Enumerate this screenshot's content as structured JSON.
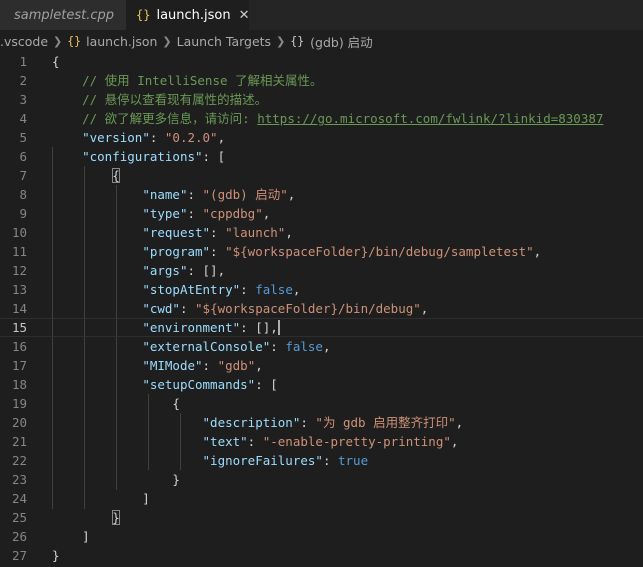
{
  "tabs": [
    {
      "label": "sampletest.cpp",
      "active": false
    },
    {
      "label": "launch.json",
      "active": true,
      "icon": "{}"
    }
  ],
  "breadcrumb": {
    "items": [
      ".vscode",
      "launch.json",
      "Launch Targets",
      "(gdb) 启动"
    ],
    "json_icon": "{}"
  },
  "colors": {
    "key": "#9cdcfe",
    "string": "#ce9178",
    "boolean": "#569cd6",
    "comment": "#6a9955",
    "background": "#1e1e1e"
  },
  "editor": {
    "current_line": 15,
    "lines": [
      {
        "n": "1",
        "tokens": [
          {
            "t": "p",
            "v": "{"
          }
        ]
      },
      {
        "n": "2",
        "tokens": [
          {
            "t": "c",
            "v": "    // 使用 IntelliSense 了解相关属性。"
          }
        ]
      },
      {
        "n": "3",
        "tokens": [
          {
            "t": "c",
            "v": "    // 悬停以查看现有属性的描述。"
          }
        ]
      },
      {
        "n": "4",
        "tokens": [
          {
            "t": "c",
            "v": "    // 欲了解更多信息，请访问: "
          },
          {
            "t": "l",
            "v": "https://go.microsoft.com/fwlink/?linkid=830387"
          }
        ]
      },
      {
        "n": "5",
        "tokens": [
          {
            "t": "p",
            "v": "    "
          },
          {
            "t": "k",
            "v": "\"version\""
          },
          {
            "t": "p",
            "v": ": "
          },
          {
            "t": "s",
            "v": "\"0.2.0\""
          },
          {
            "t": "p",
            "v": ","
          }
        ]
      },
      {
        "n": "6",
        "tokens": [
          {
            "t": "p",
            "v": "    "
          },
          {
            "t": "k",
            "v": "\"configurations\""
          },
          {
            "t": "p",
            "v": ": ["
          }
        ]
      },
      {
        "n": "7",
        "tokens": [
          {
            "t": "p",
            "v": "        "
          },
          {
            "t": "h",
            "v": "{"
          }
        ]
      },
      {
        "n": "8",
        "tokens": [
          {
            "t": "p",
            "v": "            "
          },
          {
            "t": "k",
            "v": "\"name\""
          },
          {
            "t": "p",
            "v": ": "
          },
          {
            "t": "s",
            "v": "\"(gdb) 启动\""
          },
          {
            "t": "p",
            "v": ","
          }
        ]
      },
      {
        "n": "9",
        "tokens": [
          {
            "t": "p",
            "v": "            "
          },
          {
            "t": "k",
            "v": "\"type\""
          },
          {
            "t": "p",
            "v": ": "
          },
          {
            "t": "s",
            "v": "\"cppdbg\""
          },
          {
            "t": "p",
            "v": ","
          }
        ]
      },
      {
        "n": "10",
        "tokens": [
          {
            "t": "p",
            "v": "            "
          },
          {
            "t": "k",
            "v": "\"request\""
          },
          {
            "t": "p",
            "v": ": "
          },
          {
            "t": "s",
            "v": "\"launch\""
          },
          {
            "t": "p",
            "v": ","
          }
        ]
      },
      {
        "n": "11",
        "tokens": [
          {
            "t": "p",
            "v": "            "
          },
          {
            "t": "k",
            "v": "\"program\""
          },
          {
            "t": "p",
            "v": ": "
          },
          {
            "t": "s",
            "v": "\"${workspaceFolder}/bin/debug/sampletest\""
          },
          {
            "t": "p",
            "v": ","
          }
        ]
      },
      {
        "n": "12",
        "tokens": [
          {
            "t": "p",
            "v": "            "
          },
          {
            "t": "k",
            "v": "\"args\""
          },
          {
            "t": "p",
            "v": ": [],"
          }
        ]
      },
      {
        "n": "13",
        "tokens": [
          {
            "t": "p",
            "v": "            "
          },
          {
            "t": "k",
            "v": "\"stopAtEntry\""
          },
          {
            "t": "p",
            "v": ": "
          },
          {
            "t": "b",
            "v": "false"
          },
          {
            "t": "p",
            "v": ","
          }
        ]
      },
      {
        "n": "14",
        "tokens": [
          {
            "t": "p",
            "v": "            "
          },
          {
            "t": "k",
            "v": "\"cwd\""
          },
          {
            "t": "p",
            "v": ": "
          },
          {
            "t": "s",
            "v": "\"${workspaceFolder}/bin/debug\""
          },
          {
            "t": "p",
            "v": ","
          }
        ]
      },
      {
        "n": "15",
        "tokens": [
          {
            "t": "p",
            "v": "            "
          },
          {
            "t": "k",
            "v": "\"environment\""
          },
          {
            "t": "p",
            "v": ": [],"
          },
          {
            "t": "cur",
            "v": ""
          }
        ]
      },
      {
        "n": "16",
        "tokens": [
          {
            "t": "p",
            "v": "            "
          },
          {
            "t": "k",
            "v": "\"externalConsole\""
          },
          {
            "t": "p",
            "v": ": "
          },
          {
            "t": "b",
            "v": "false"
          },
          {
            "t": "p",
            "v": ","
          }
        ]
      },
      {
        "n": "17",
        "tokens": [
          {
            "t": "p",
            "v": "            "
          },
          {
            "t": "k",
            "v": "\"MIMode\""
          },
          {
            "t": "p",
            "v": ": "
          },
          {
            "t": "s",
            "v": "\"gdb\""
          },
          {
            "t": "p",
            "v": ","
          }
        ]
      },
      {
        "n": "18",
        "tokens": [
          {
            "t": "p",
            "v": "            "
          },
          {
            "t": "k",
            "v": "\"setupCommands\""
          },
          {
            "t": "p",
            "v": ": ["
          }
        ]
      },
      {
        "n": "19",
        "tokens": [
          {
            "t": "p",
            "v": "                {"
          }
        ]
      },
      {
        "n": "20",
        "tokens": [
          {
            "t": "p",
            "v": "                    "
          },
          {
            "t": "k",
            "v": "\"description\""
          },
          {
            "t": "p",
            "v": ": "
          },
          {
            "t": "s",
            "v": "\"为 gdb 启用整齐打印\""
          },
          {
            "t": "p",
            "v": ","
          }
        ]
      },
      {
        "n": "21",
        "tokens": [
          {
            "t": "p",
            "v": "                    "
          },
          {
            "t": "k",
            "v": "\"text\""
          },
          {
            "t": "p",
            "v": ": "
          },
          {
            "t": "s",
            "v": "\"-enable-pretty-printing\""
          },
          {
            "t": "p",
            "v": ","
          }
        ]
      },
      {
        "n": "22",
        "tokens": [
          {
            "t": "p",
            "v": "                    "
          },
          {
            "t": "k",
            "v": "\"ignoreFailures\""
          },
          {
            "t": "p",
            "v": ": "
          },
          {
            "t": "b",
            "v": "true"
          }
        ]
      },
      {
        "n": "23",
        "tokens": [
          {
            "t": "p",
            "v": "                }"
          }
        ]
      },
      {
        "n": "24",
        "tokens": [
          {
            "t": "p",
            "v": "            ]"
          }
        ]
      },
      {
        "n": "25",
        "tokens": [
          {
            "t": "p",
            "v": "        "
          },
          {
            "t": "h",
            "v": "}"
          }
        ]
      },
      {
        "n": "26",
        "tokens": [
          {
            "t": "p",
            "v": "    ]"
          }
        ]
      },
      {
        "n": "27",
        "tokens": [
          {
            "t": "p",
            "v": "}"
          }
        ]
      }
    ]
  }
}
